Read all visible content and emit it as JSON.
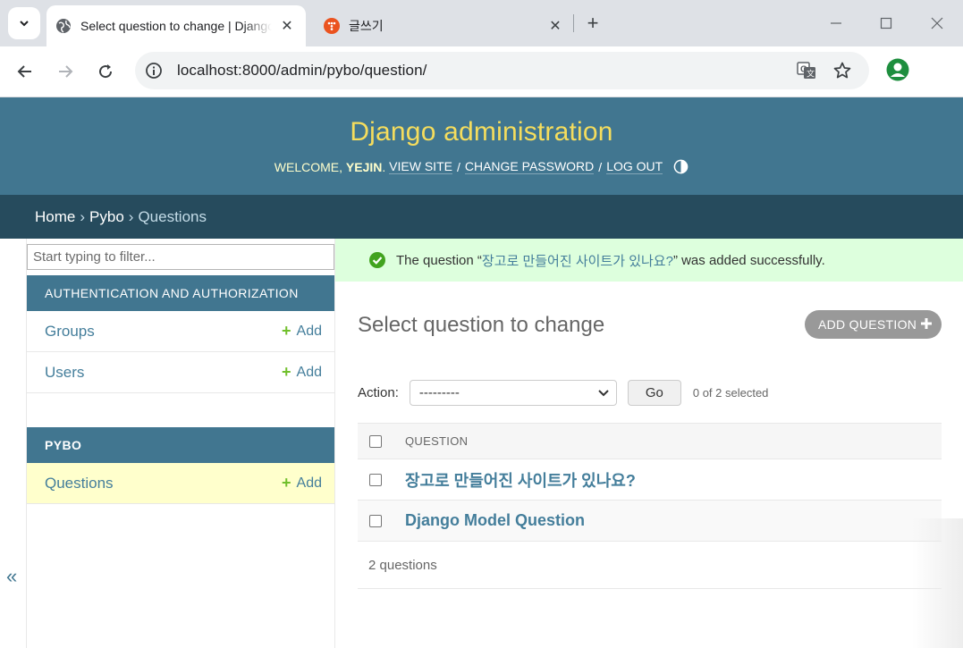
{
  "browser": {
    "tabs": [
      {
        "title": "Select question to change | Django site admin",
        "active": true,
        "favicon": "globe-icon"
      },
      {
        "title": "글쓰기",
        "active": false,
        "favicon": "tistory-icon"
      }
    ],
    "url": "localhost:8000/admin/pybo/question/"
  },
  "header": {
    "brand": "Django administration",
    "welcome": "WELCOME,",
    "user": "YEJIN",
    "view_site": "View site",
    "change_password": "Change password",
    "log_out": "Log out"
  },
  "breadcrumbs": {
    "home": "Home",
    "app": "Pybo",
    "current": "Questions",
    "separator": "›"
  },
  "sidebar": {
    "filter_placeholder": "Start typing to filter...",
    "collapse_glyph": "«",
    "apps": [
      {
        "caption": "AUTHENTICATION AND AUTHORIZATION",
        "models": [
          {
            "name": "Groups",
            "add": "Add"
          },
          {
            "name": "Users",
            "add": "Add"
          }
        ]
      },
      {
        "caption": "PYBO",
        "models": [
          {
            "name": "Questions",
            "add": "Add",
            "selected": true
          }
        ]
      }
    ]
  },
  "message": {
    "prefix": "The question “",
    "object": "장고로 만들어진 사이트가 있나요?",
    "suffix": "” was added successfully."
  },
  "content": {
    "title": "Select question to change",
    "add_button": "ADD QUESTION",
    "action_label": "Action:",
    "action_selected": "---------",
    "go_button": "Go",
    "counter": "0 of 2 selected",
    "column_header": "QUESTION",
    "rows": [
      {
        "question": "장고로 만들어진 사이트가 있나요?"
      },
      {
        "question": "Django Model Question"
      }
    ],
    "paginator": "2 questions"
  },
  "colors": {
    "header_bg": "#417690",
    "brand": "#f5dd5d",
    "breadcrumbs_bg": "#264b5d",
    "link": "#447e9b",
    "success_bg": "#ddffdd",
    "selected_row": "#ffffcc",
    "add_plus": "#70bf2b"
  }
}
